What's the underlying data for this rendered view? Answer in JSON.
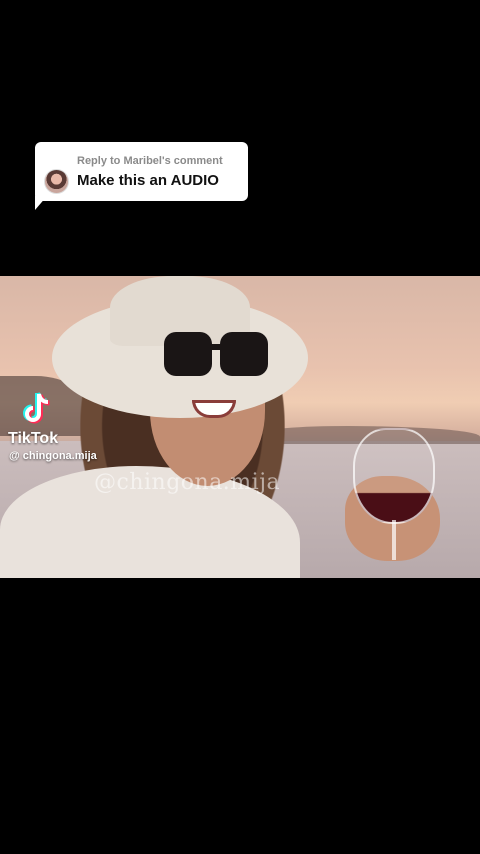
{
  "reply": {
    "header": "Reply to Maribel's comment",
    "text": "Make this an AUDIO"
  },
  "video": {
    "watermark": "@chingona.mija"
  },
  "tiktok": {
    "brand": "TikTok",
    "handle": "@ chingona.mija",
    "logo_icon": "tiktok-note-icon"
  }
}
